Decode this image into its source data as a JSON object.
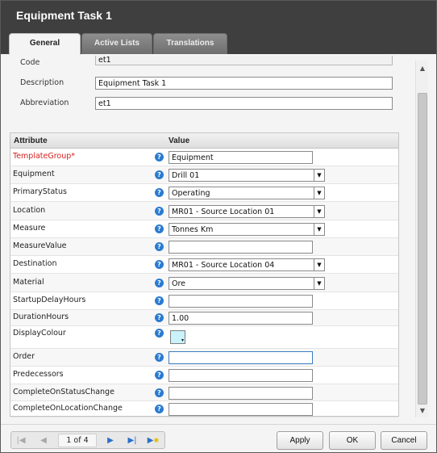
{
  "window": {
    "title": "Equipment Task 1"
  },
  "tabs": [
    {
      "label": "General",
      "active": true
    },
    {
      "label": "Active Lists",
      "active": false
    },
    {
      "label": "Translations",
      "active": false
    }
  ],
  "fields": {
    "code": {
      "label": "Code",
      "value": "et1"
    },
    "description": {
      "label": "Description",
      "value": "Equipment Task 1"
    },
    "abbreviation": {
      "label": "Abbreviation",
      "value": "et1"
    }
  },
  "grid": {
    "headers": {
      "attribute": "Attribute",
      "value": "Value"
    },
    "rows": [
      {
        "attribute": "TemplateGroup*",
        "value": "Equipment",
        "required": true,
        "type": "text"
      },
      {
        "attribute": "Equipment",
        "value": "Drill 01",
        "type": "dropdown"
      },
      {
        "attribute": "PrimaryStatus",
        "value": "Operating",
        "type": "dropdown"
      },
      {
        "attribute": "Location",
        "value": "MR01 - Source Location 01",
        "type": "dropdown"
      },
      {
        "attribute": "Measure",
        "value": "Tonnes Km",
        "type": "dropdown"
      },
      {
        "attribute": "MeasureValue",
        "value": "",
        "type": "text"
      },
      {
        "attribute": "Destination",
        "value": "MR01 - Source Location 04",
        "type": "dropdown"
      },
      {
        "attribute": "Material",
        "value": "Ore",
        "type": "dropdown"
      },
      {
        "attribute": "StartupDelayHours",
        "value": "",
        "type": "text"
      },
      {
        "attribute": "DurationHours",
        "value": "1.00",
        "type": "text"
      },
      {
        "attribute": "DisplayColour",
        "value": "",
        "type": "color",
        "color": "#c9f2fb"
      },
      {
        "attribute": "Order",
        "value": "",
        "type": "text",
        "focused": true
      },
      {
        "attribute": "Predecessors",
        "value": "",
        "type": "text"
      },
      {
        "attribute": "CompleteOnStatusChange",
        "value": "",
        "type": "text"
      },
      {
        "attribute": "CompleteOnLocationChange",
        "value": "",
        "type": "text"
      }
    ]
  },
  "pager": {
    "text": "1 of 4"
  },
  "buttons": {
    "apply": "Apply",
    "ok": "OK",
    "cancel": "Cancel"
  },
  "icons": {
    "help": "help-icon",
    "first": "first-page-icon",
    "prev": "prev-page-icon",
    "next": "next-page-icon",
    "last": "last-page-icon",
    "new": "new-record-icon"
  },
  "colors": {
    "accent": "#2a7bd1",
    "titlebar": "#3f3f3f",
    "required": "#d62020"
  }
}
